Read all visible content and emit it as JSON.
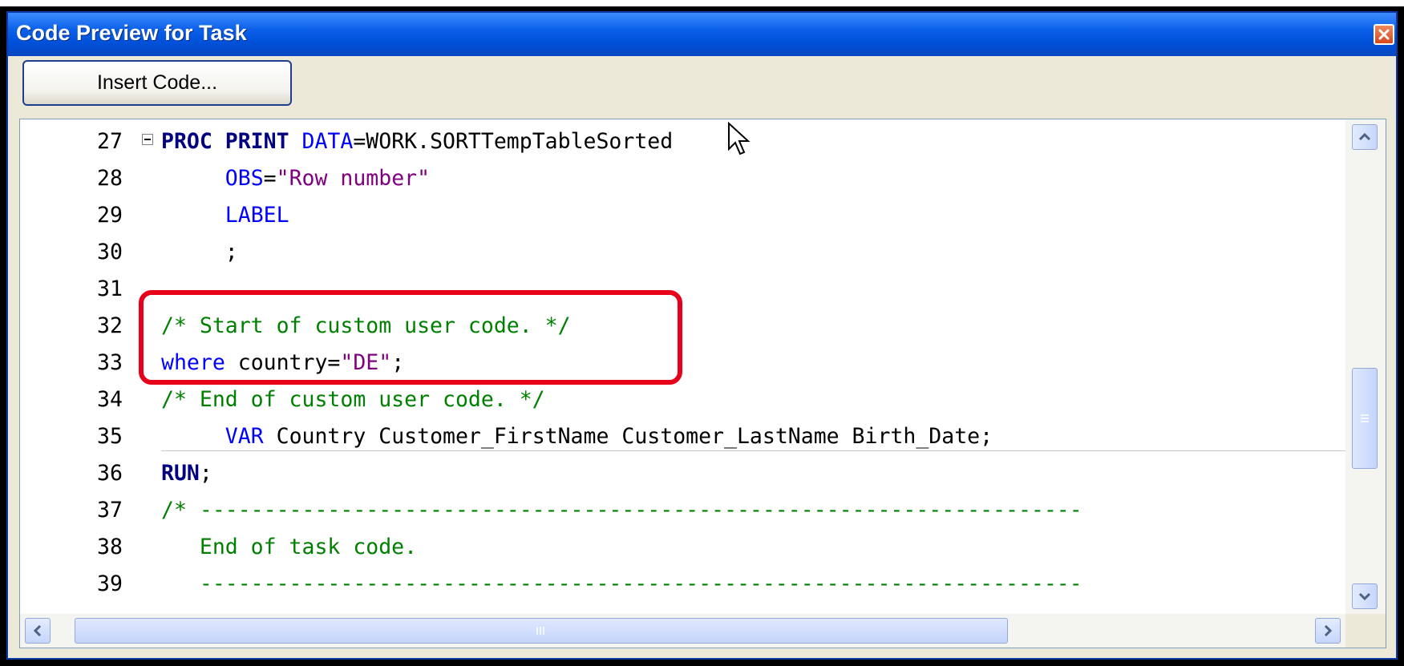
{
  "window": {
    "title": "Code Preview for Task"
  },
  "toolbar": {
    "insert_label": "Insert Code..."
  },
  "editor": {
    "lines": [
      {
        "num": "27",
        "parts": [
          {
            "t": "PROC PRINT",
            "c": "kw"
          },
          {
            "t": " ",
            "c": ""
          },
          {
            "t": "DATA",
            "c": "bl"
          },
          {
            "t": "=WORK.SORTTempTableSorted",
            "c": ""
          }
        ]
      },
      {
        "num": "28",
        "parts": [
          {
            "t": "     ",
            "c": ""
          },
          {
            "t": "OBS",
            "c": "bl"
          },
          {
            "t": "=",
            "c": ""
          },
          {
            "t": "\"Row number\"",
            "c": "str"
          }
        ]
      },
      {
        "num": "29",
        "parts": [
          {
            "t": "     ",
            "c": ""
          },
          {
            "t": "LABEL",
            "c": "bl"
          }
        ]
      },
      {
        "num": "30",
        "parts": [
          {
            "t": "     ;",
            "c": ""
          }
        ]
      },
      {
        "num": "31",
        "parts": []
      },
      {
        "num": "32",
        "parts": [
          {
            "t": "/* Start of custom user code. */",
            "c": "cm"
          }
        ]
      },
      {
        "num": "33",
        "parts": [
          {
            "t": "where",
            "c": "bl"
          },
          {
            "t": " country=",
            "c": ""
          },
          {
            "t": "\"DE\"",
            "c": "str"
          },
          {
            "t": ";",
            "c": ""
          }
        ]
      },
      {
        "num": "34",
        "parts": [
          {
            "t": "/* End of custom user code. */",
            "c": "cm"
          }
        ]
      },
      {
        "num": "35",
        "parts": [
          {
            "t": "     ",
            "c": ""
          },
          {
            "t": "VAR",
            "c": "bl"
          },
          {
            "t": " Country Customer_FirstName Customer_LastName Birth_Date;",
            "c": ""
          }
        ]
      },
      {
        "num": "36",
        "parts": [
          {
            "t": "RUN",
            "c": "kw"
          },
          {
            "t": ";",
            "c": ""
          }
        ]
      },
      {
        "num": "37",
        "parts": [
          {
            "t": "/* ---------------------------------------------------------------------",
            "c": "cm"
          }
        ]
      },
      {
        "num": "38",
        "parts": [
          {
            "t": "   End of task code.",
            "c": "cm"
          }
        ]
      },
      {
        "num": "39",
        "parts": [
          {
            "t": "   ---------------------------------------------------------------------",
            "c": "cm"
          }
        ]
      }
    ]
  },
  "icons": {
    "close": "close-icon",
    "scroll_up": "chevron-up-icon",
    "scroll_down": "chevron-down-icon",
    "scroll_left": "chevron-left-icon",
    "scroll_right": "chevron-right-icon",
    "collapse": "collapse-minus-icon",
    "cursor": "mouse-pointer-icon"
  },
  "colors": {
    "titlebar": "#0a5fe8",
    "highlight": "#e8001a",
    "keyword": "#000080",
    "comment": "#008000",
    "string": "#800080",
    "option": "#0000ff"
  }
}
